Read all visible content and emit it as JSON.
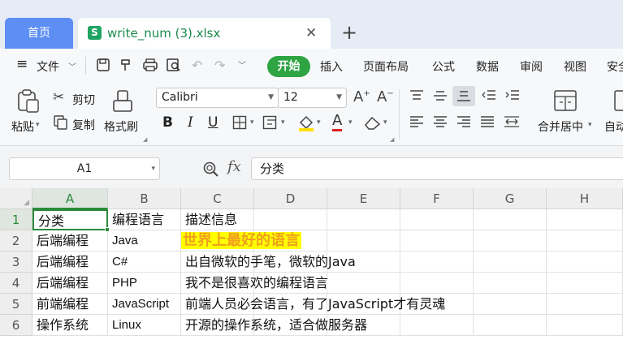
{
  "tabs": {
    "home_label": "首页",
    "file_icon_label": "S",
    "file_name": "write_num (3).xlsx",
    "close_glyph": "✕",
    "add_glyph": "+"
  },
  "menubar": {
    "hamburger": "≡",
    "file_label": "文件",
    "start_label": "开始",
    "items": [
      "插入",
      "页面布局",
      "公式",
      "数据",
      "审阅",
      "视图",
      "安全"
    ],
    "icons": [
      "save-icon",
      "format-painter-icon",
      "print-icon",
      "print-preview-icon",
      "undo-icon",
      "redo-icon",
      "more-icon"
    ]
  },
  "ribbon": {
    "paste": "粘贴",
    "cut": "剪切",
    "copy": "复制",
    "format_painter": "格式刷",
    "font_name": "Calibri",
    "font_size": "12",
    "bold": "B",
    "italic": "I",
    "underline": "U",
    "font_color_letter": "A",
    "merge_center": "合并居中",
    "auto_wrap": "自动"
  },
  "formula_bar": {
    "cell_ref": "A1",
    "fx": "fx",
    "content": "分类"
  },
  "sheet": {
    "columns": [
      "A",
      "B",
      "C",
      "D",
      "E",
      "F",
      "G",
      "H"
    ],
    "rows": [
      "1",
      "2",
      "3",
      "4",
      "5",
      "6"
    ],
    "cells": [
      [
        "分类",
        "编程语言",
        "描述信息"
      ],
      [
        "后端编程",
        "Java",
        "世界上最好的语言"
      ],
      [
        "后端编程",
        "C#",
        "出自微软的手笔，微软的Java"
      ],
      [
        "后端编程",
        "PHP",
        "我不是很喜欢的编程语言"
      ],
      [
        "前端编程",
        "JavaScript",
        "前端人员必会语言，有了JavaScript才有灵魂"
      ],
      [
        "操作系统",
        "Linux",
        "开源的操作系统，适合做服务器"
      ]
    ],
    "highlight": {
      "background": "#ffff00",
      "text_color": "#f0a01e"
    }
  },
  "colors": {
    "accent_green": "#2ea443",
    "home_tab_blue": "#5d8ef4",
    "excel_icon_green": "#1fa463"
  }
}
